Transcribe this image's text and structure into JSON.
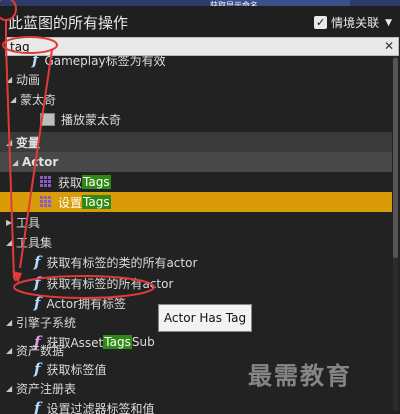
{
  "window": {
    "title": "此蓝图的所有操作",
    "context_toggle": "情境关联",
    "background_node_label": "获取显示命名"
  },
  "search": {
    "value": "tag"
  },
  "tree": {
    "row0": {
      "label": "Gameplay标签为有效"
    },
    "cat_anim": "动画",
    "cat_montage": "蒙太奇",
    "play_montage": "播放蒙太奇",
    "cat_variables": "变量",
    "cat_actor": "Actor",
    "get_tags": {
      "pre": "获取",
      "hl": "Tags",
      "post": ""
    },
    "set_tags": {
      "pre": "设置 ",
      "hl": "Tags",
      "post": ""
    },
    "cat_tools": "工具",
    "cat_utilities": "工具集",
    "get_all_actors_of_class_with_tag": "获取有标签的类的所有actor",
    "get_all_actors_with_tag": "获取有标签的所有actor",
    "actor_has_tag": "Actor拥有标签",
    "cat_engine_subsystem": "引擎子系统",
    "get_asset_tags": {
      "pre": "获取Asset",
      "hl": "Tags",
      "post": "Sub"
    },
    "cat_asset_data": "资产数据",
    "get_tag_value": "获取标签值",
    "cat_asset_registry": "资产注册表",
    "set_filter_tag_value": "设置过滤器标签和值"
  },
  "tooltip": "Actor Has Tag",
  "watermark": "最需教育",
  "colors": {
    "selection": "#d99b08",
    "highlight": "#2d8a12",
    "annotation": "#e23a3a",
    "function_icon": "#b6d9ff",
    "variable_icon": "#8a5cc8"
  }
}
